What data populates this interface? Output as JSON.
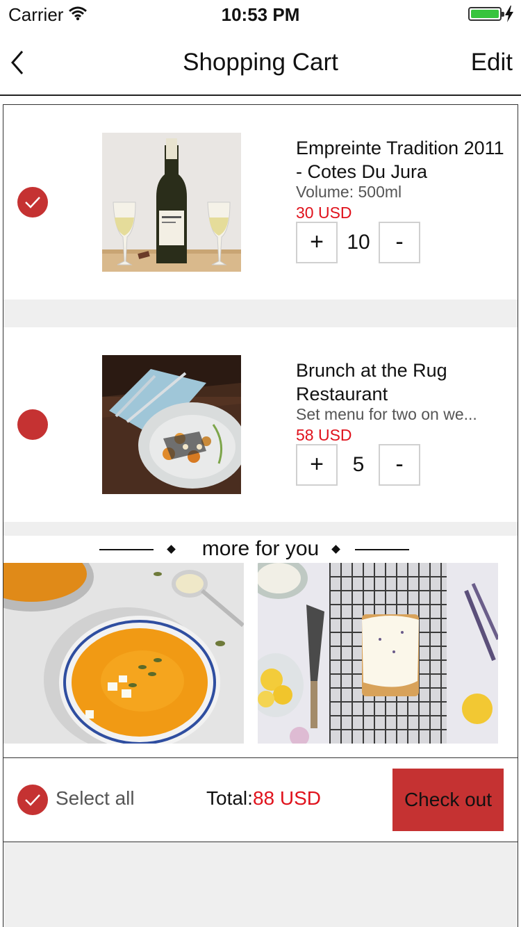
{
  "status_bar": {
    "carrier": "Carrier",
    "time": "10:53 PM",
    "battery_level": 1.0
  },
  "nav": {
    "title": "Shopping Cart",
    "edit_label": "Edit"
  },
  "items": [
    {
      "name": "Empreinte Tradition 2011 - Cotes Du Jura",
      "subtitle": "Volume: 500ml",
      "price": "30 USD",
      "quantity": "10",
      "selected": true,
      "image": "wine-bottle-image"
    },
    {
      "name": "Brunch at the Rug Restaurant",
      "subtitle": "Set menu for two on we...",
      "price": "58 USD",
      "quantity": "5",
      "selected": false,
      "image": "brunch-plate-image"
    }
  ],
  "qty": {
    "plus": "+",
    "minus": "-"
  },
  "more": {
    "title": "more for you",
    "items": [
      {
        "image": "pumpkin-soup-image"
      },
      {
        "image": "lemon-cake-image"
      }
    ]
  },
  "footer": {
    "select_all": "Select all",
    "total_label": "Total:",
    "total_amount": "88 USD",
    "checkout": "Check out"
  },
  "colors": {
    "accent": "#c53232",
    "price": "#e0121c",
    "separator": "#efefef"
  }
}
